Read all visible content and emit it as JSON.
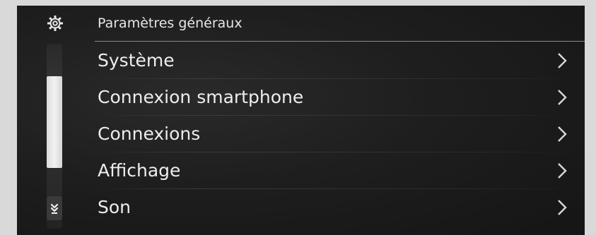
{
  "header": {
    "title": "Paramètres généraux",
    "icon": "gear-icon"
  },
  "scrollbar": {
    "down_icon": "double-chevron-down-icon"
  },
  "menu": {
    "items": [
      {
        "label": "Système",
        "icon": "chevron-right-icon"
      },
      {
        "label": "Connexion smartphone",
        "icon": "chevron-right-icon"
      },
      {
        "label": "Connexions",
        "icon": "chevron-right-icon"
      },
      {
        "label": "Affichage",
        "icon": "chevron-right-icon"
      },
      {
        "label": "Son",
        "icon": "chevron-right-icon"
      }
    ]
  },
  "colors": {
    "background": "#1e1e1e",
    "text": "#ededed",
    "frame": "#d9d9d9"
  }
}
